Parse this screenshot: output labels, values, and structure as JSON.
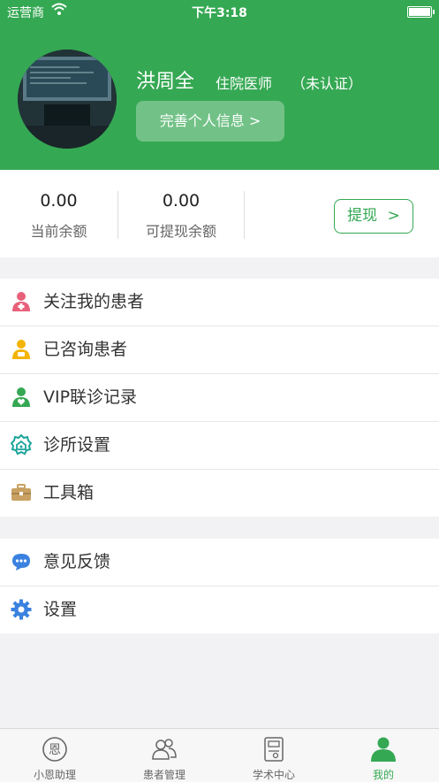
{
  "status_bar": {
    "carrier": "运营商",
    "time": "下午3:18"
  },
  "profile": {
    "name": "洪周全",
    "title": "住院医师",
    "auth_status": "（未认证）",
    "complete_button": "完善个人信息 >"
  },
  "balance": {
    "current_value": "0.00",
    "current_label": "当前余额",
    "withdrawable_value": "0.00",
    "withdrawable_label": "可提现余额",
    "withdraw_button": "提现",
    "withdraw_chevron": ">"
  },
  "menu_group_1": [
    {
      "label": "关注我的患者",
      "icon": "patient-follow-icon"
    },
    {
      "label": "已咨询患者",
      "icon": "consulted-patient-icon"
    },
    {
      "label": "VIP联诊记录",
      "icon": "vip-record-icon"
    },
    {
      "label": "诊所设置",
      "icon": "clinic-settings-icon"
    },
    {
      "label": "工具箱",
      "icon": "toolbox-icon"
    }
  ],
  "menu_group_2": [
    {
      "label": "意见反馈",
      "icon": "feedback-icon"
    },
    {
      "label": "设置",
      "icon": "gear-icon"
    }
  ],
  "tabbar": [
    {
      "label": "小恩助理",
      "icon": "assistant-icon",
      "active": false,
      "glyph": "恩"
    },
    {
      "label": "患者管理",
      "icon": "patients-icon",
      "active": false
    },
    {
      "label": "学术中心",
      "icon": "academic-icon",
      "active": false
    },
    {
      "label": "我的",
      "icon": "profile-icon",
      "active": true
    }
  ],
  "colors": {
    "brand": "#35a853",
    "background": "#f2f2f4"
  }
}
